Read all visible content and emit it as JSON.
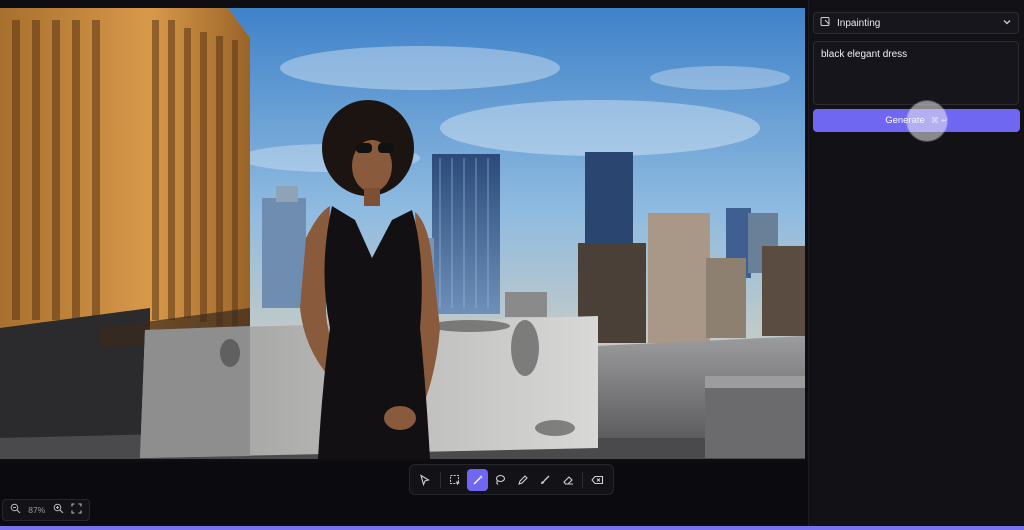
{
  "panel": {
    "mode": {
      "label": "Inpainting",
      "icon": "inpaint-icon",
      "caret": "chevron-down-icon"
    },
    "prompt": {
      "value": "black elegant dress"
    },
    "generate": {
      "label": "Generate",
      "shortcut": "⌘ ↵"
    }
  },
  "toolbar": {
    "tools": [
      {
        "name": "select-tool",
        "icon": "cursor-icon",
        "active": false
      },
      {
        "name": "box-select-tool",
        "icon": "box-select-icon",
        "active": false
      },
      {
        "name": "magic-wand-tool",
        "icon": "magic-wand-icon",
        "active": true
      },
      {
        "name": "lasso-tool",
        "icon": "lasso-icon",
        "active": false
      },
      {
        "name": "pen-tool",
        "icon": "pen-icon",
        "active": false
      },
      {
        "name": "brush-tool",
        "icon": "brush-icon",
        "active": false
      },
      {
        "name": "eraser-tool",
        "icon": "eraser-icon",
        "active": false
      },
      {
        "name": "clear-tool",
        "icon": "backspace-icon",
        "active": false
      }
    ]
  },
  "zoom": {
    "value": "87%"
  },
  "colors": {
    "accent": "#6f66f2",
    "panel": "#111116",
    "background": "#0b0b0f"
  }
}
